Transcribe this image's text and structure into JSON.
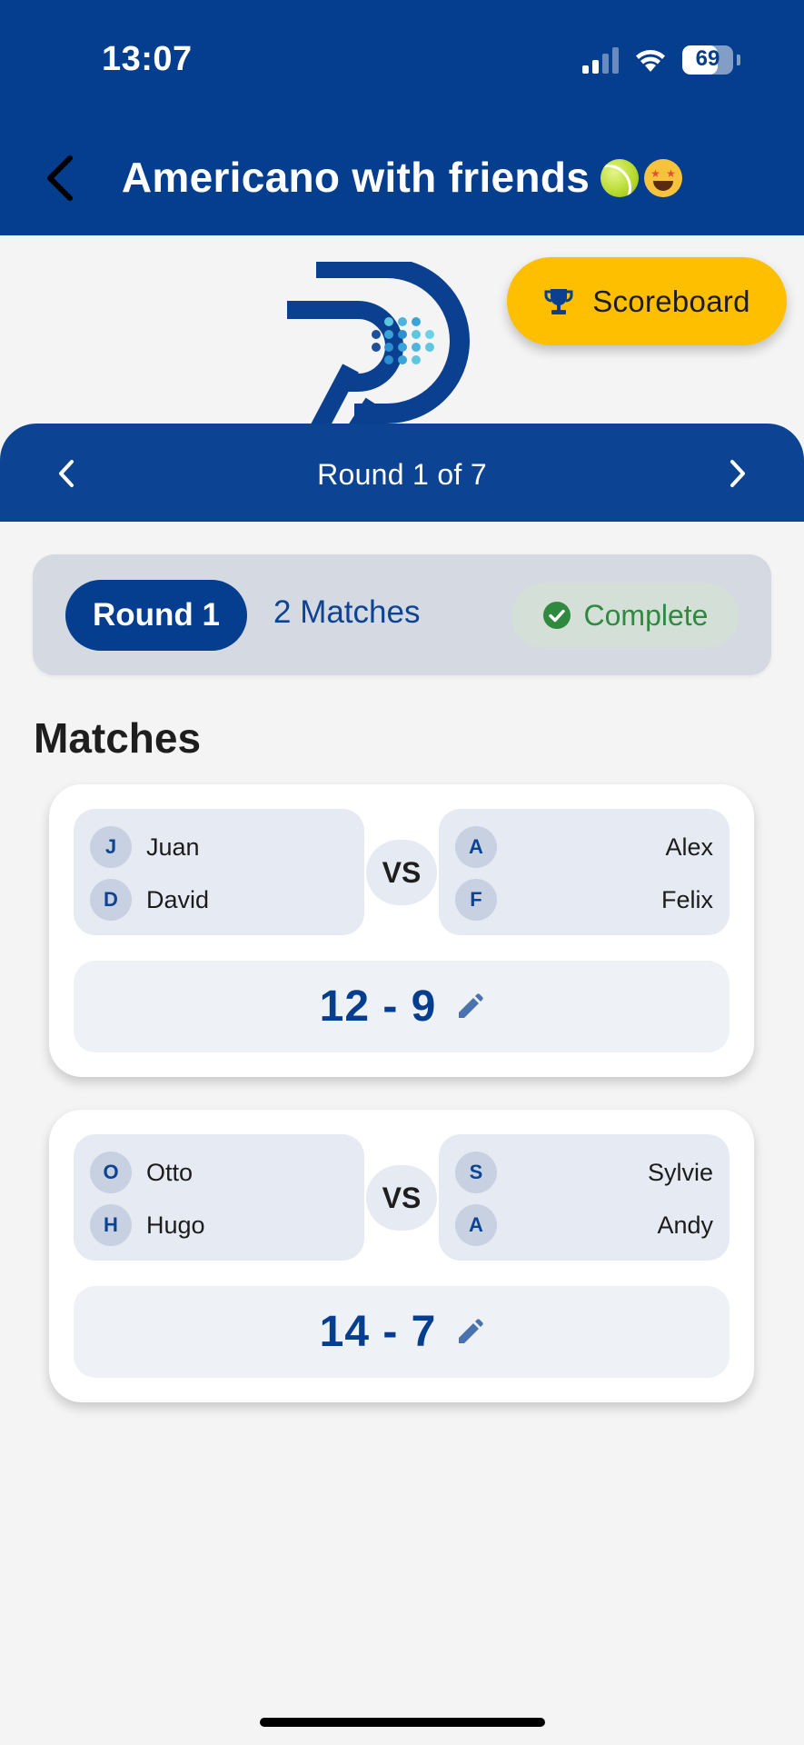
{
  "status_bar": {
    "time": "13:07",
    "battery": "69"
  },
  "header": {
    "title": "Americano with friends",
    "back_icon": "chevron-left-icon"
  },
  "scoreboard": {
    "label": "Scoreboard",
    "icon": "trophy-icon",
    "color": "#fdbf00"
  },
  "round_nav": {
    "label": "Round 1 of 7"
  },
  "round_summary": {
    "round": "Round 1",
    "matches": "2 Matches",
    "status": "Complete",
    "status_color": "#2f8a3f"
  },
  "section": {
    "title": "Matches"
  },
  "matches": [
    {
      "team_a": [
        {
          "initial": "J",
          "name": "Juan"
        },
        {
          "initial": "D",
          "name": "David"
        }
      ],
      "vs": "VS",
      "team_b": [
        {
          "initial": "A",
          "name": "Alex"
        },
        {
          "initial": "F",
          "name": "Felix"
        }
      ],
      "score": "12 - 9"
    },
    {
      "team_a": [
        {
          "initial": "O",
          "name": "Otto"
        },
        {
          "initial": "H",
          "name": "Hugo"
        }
      ],
      "vs": "VS",
      "team_b": [
        {
          "initial": "S",
          "name": "Sylvie"
        },
        {
          "initial": "A",
          "name": "Andy"
        }
      ],
      "score": "14 - 7"
    }
  ],
  "colors": {
    "primary": "#053d8f",
    "background": "#f4f4f4"
  }
}
